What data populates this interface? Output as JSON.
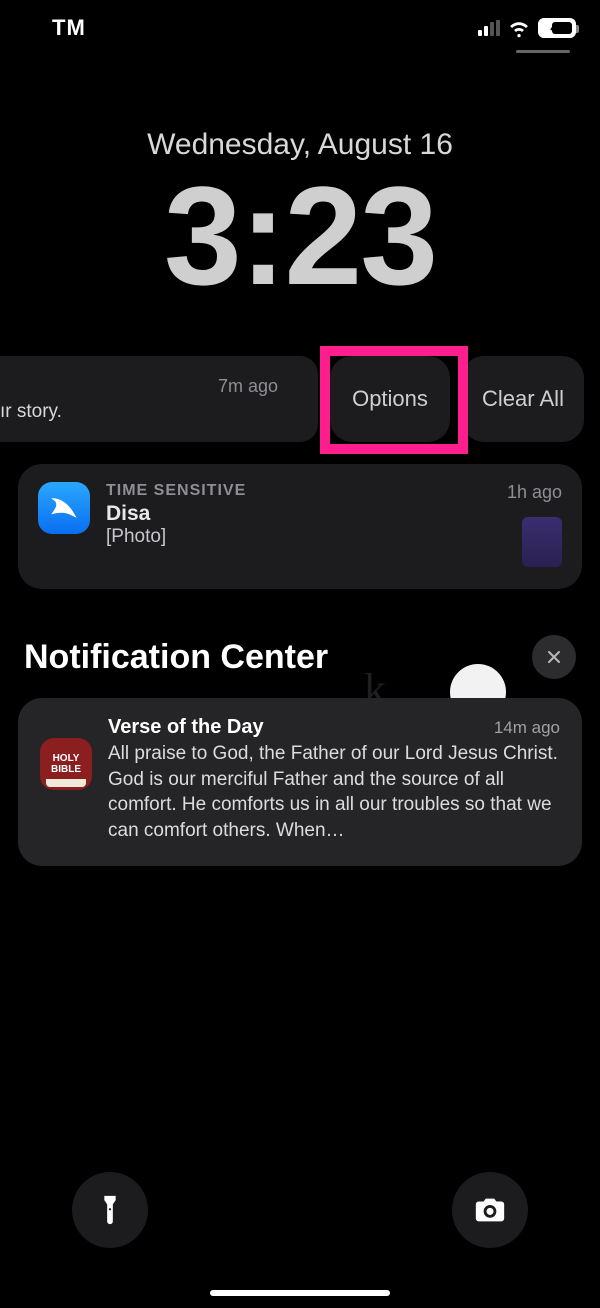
{
  "status": {
    "carrier": "TM",
    "battery_pct": "40"
  },
  "datetime": {
    "date": "Wednesday, August 16",
    "time": "3:23"
  },
  "swipe": {
    "story_ago": "7m ago",
    "story_body": "ır story.",
    "options_label": "Options",
    "clear_all_label": "Clear All"
  },
  "notif1": {
    "tag": "TIME SENSITIVE",
    "title": "Disa",
    "subtitle": "[Photo]",
    "ago": "1h ago"
  },
  "nc": {
    "title": "Notification Center"
  },
  "verse": {
    "icon_line1": "HOLY",
    "icon_line2": "BIBLE",
    "title": "Verse of the Day",
    "ago": "14m ago",
    "body": "All praise to God, the Father of our Lord Jesus Christ. God is our merciful Father and the source of all comfort. He comforts us in all our troubles so that we can comfort others. When…"
  }
}
